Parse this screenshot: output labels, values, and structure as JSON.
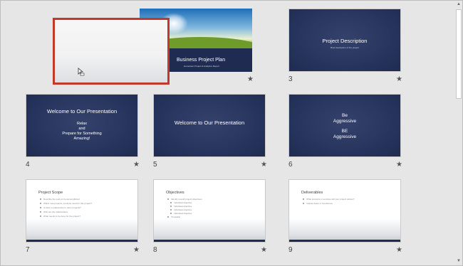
{
  "slides": {
    "s1": {
      "title": "Business Project Plan",
      "subtitle": "Hometown Project & Analytics Report"
    },
    "s3": {
      "number": "3",
      "title": "Project Description",
      "subtitle": "Brief description of the project"
    },
    "s4": {
      "number": "4",
      "title": "Welcome to Our Presentation",
      "body": [
        "Relax",
        "and",
        "Prepare for Something",
        "Amazing!"
      ]
    },
    "s5": {
      "number": "5",
      "title": "Welcome to Our Presentation"
    },
    "s6": {
      "number": "6",
      "lines": [
        "Be",
        "Aggressive",
        "",
        "BE",
        "Aggressive"
      ]
    },
    "s7": {
      "number": "7",
      "title": "Project Scope",
      "bullets": [
        "Describe the work to be accomplished",
        "Which new projects, products need for this project?",
        "Is there a relationship to other projects?",
        "Who are the stakeholders",
        "What needs to be done for the project?"
      ]
    },
    "s8": {
      "number": "8",
      "title": "Objectives",
      "bullets": [
        "Identify overall project objectives",
        "Individual objective",
        "Individual objective",
        "Individual objective",
        "Individual objective",
        "Timetable"
      ]
    },
    "s9": {
      "number": "9",
      "title": "Deliverables",
      "bullets": [
        "What products or services will your project deliver?",
        "Include dates or timeframes"
      ]
    }
  },
  "icons": {
    "star": "★",
    "scroll_up": "▲",
    "scroll_down": "▼",
    "cursor": "move-cursor-icon"
  },
  "colors": {
    "selection": "#c0392b",
    "slide_dark": "#283660"
  }
}
